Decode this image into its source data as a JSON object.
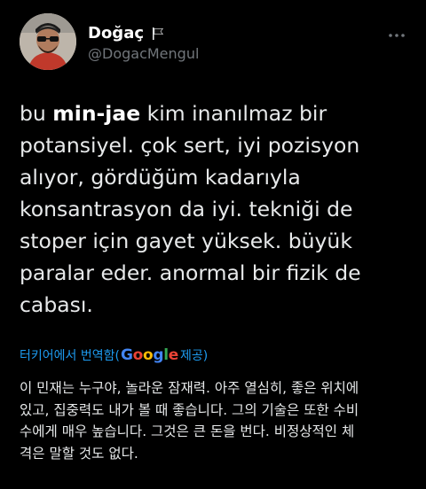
{
  "author": {
    "name": "Doğaç",
    "handle": "@DogacMengul",
    "flag_icon": "black-flag-icon"
  },
  "more_icon": "more-dots-icon",
  "tweet": {
    "mention": "min-jae",
    "text_before": "bu ",
    "text_after": " kim inanılmaz bir\npotansiyel. çok sert, iyi pozisyon\nalıyor, gördüğüm kadarıyla\nkonsantrasyon da iyi. tekniği de\nstoper için gayet yüksek. büyük\nparalar eder. anormal bir fizik de\ncabası."
  },
  "translation": {
    "label_prefix": "터키어에서 번역함(",
    "provider": "Google",
    "label_suffix": " 제공)",
    "text": "이 민재는 누구야, 놀라운 잠재력. 아주 열심히, 좋은 위치에\n있고, 집중력도 내가 볼 때 좋습니다. 그의 기술은 또한 수비\n수에게 매우 높습니다. 그것은 큰 돈을 번다. 비정상적인 체\n격은 말할 것도 없다."
  },
  "colors": {
    "background": "#000000",
    "text": "#e7e9ea",
    "secondary": "#71767b",
    "link": "#1d9bf0"
  }
}
